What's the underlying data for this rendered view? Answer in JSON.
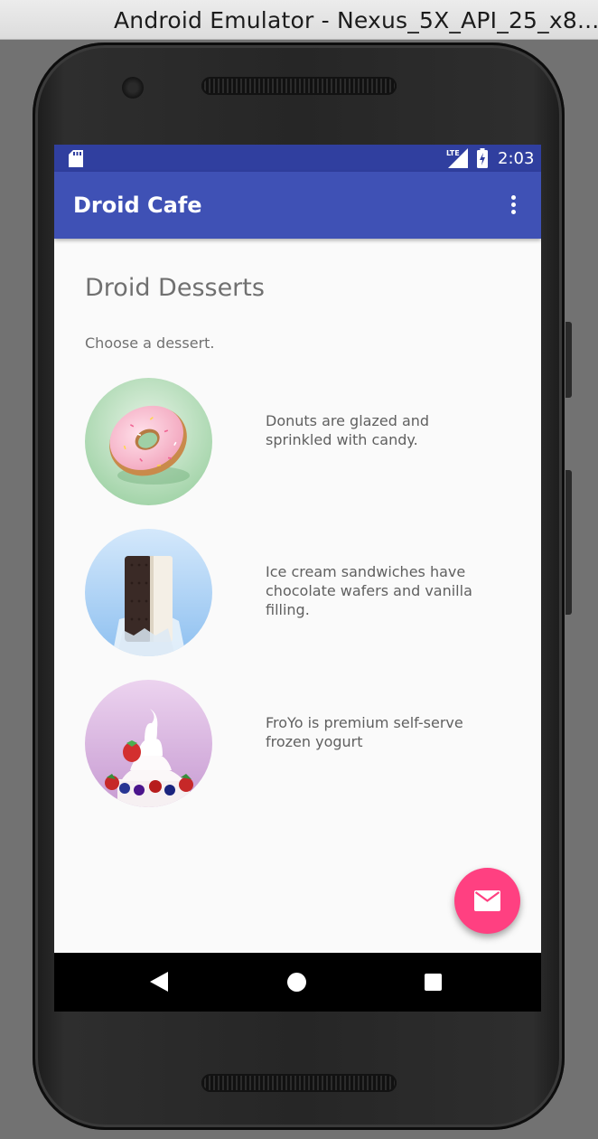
{
  "window": {
    "title": "Android Emulator - Nexus_5X_API_25_x8..."
  },
  "status_bar": {
    "time": "2:03",
    "network_badge": "LTE",
    "icons": [
      "sd-card-icon",
      "lte-signal-icon",
      "battery-charging-icon"
    ]
  },
  "app_bar": {
    "title": "Droid Cafe",
    "menu_icon": "overflow-menu-icon"
  },
  "content": {
    "heading": "Droid Desserts",
    "subtitle": "Choose a dessert.",
    "desserts": [
      {
        "image": "donut-image",
        "description": "Donuts are glazed and sprinkled with candy."
      },
      {
        "image": "ice-cream-sandwich-image",
        "description": "Ice cream sandwiches have chocolate wafers and vanilla filling."
      },
      {
        "image": "froyo-image",
        "description": "FroYo is premium self-serve frozen yogurt"
      }
    ]
  },
  "fab": {
    "icon": "mail-icon"
  },
  "nav_bar": {
    "icons": [
      "back-icon",
      "home-icon",
      "recents-icon"
    ]
  },
  "colors": {
    "status_bar": "#303f9f",
    "app_bar": "#3f51b5",
    "fab": "#ff4081",
    "background": "#fafafa",
    "text": "#707070"
  }
}
